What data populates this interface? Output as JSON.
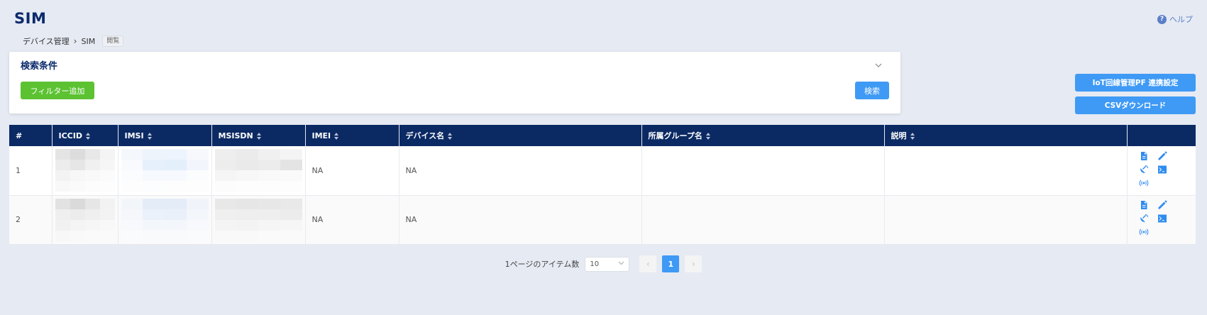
{
  "header": {
    "title": "SIM",
    "help_label": "ヘルプ",
    "help_glyph": "?"
  },
  "breadcrumb": {
    "parent": "デバイス管理",
    "separator": "›",
    "current": "SIM",
    "mode_badge": "閲覧"
  },
  "search": {
    "title": "検索条件",
    "add_filter_label": "フィルター追加",
    "search_label": "検索"
  },
  "side_buttons": {
    "iot_settings": "IoT回線管理PF 連携設定",
    "csv_download": "CSVダウンロード"
  },
  "table": {
    "columns": [
      "#",
      "ICCID",
      "IMSI",
      "MSISDN",
      "IMEI",
      "デバイス名",
      "所属グループ名",
      "説明",
      ""
    ],
    "rows": [
      {
        "index": "1",
        "iccid": "",
        "imsi": "",
        "msisdn": "",
        "imei": "NA",
        "device_name": "NA",
        "group": "",
        "description": ""
      },
      {
        "index": "2",
        "iccid": "",
        "imsi": "",
        "msisdn": "",
        "imei": "NA",
        "device_name": "NA",
        "group": "",
        "description": ""
      }
    ],
    "row_action_icons": [
      "document-icon",
      "edit-pencil-icon",
      "satellite-dish-icon",
      "terminal-icon",
      "signal-broadcast-icon"
    ]
  },
  "pagination": {
    "per_page_label": "1ページのアイテム数",
    "per_page_value": "10",
    "prev_glyph": "‹",
    "next_glyph": "›",
    "current_page": "1"
  },
  "colors": {
    "background": "#e6eaf3",
    "header_navy": "#0b2a64",
    "title_navy": "#0b2a6b",
    "primary_blue": "#3f9af5",
    "success_green": "#5cc232",
    "icon_blue": "#2f8cf0"
  }
}
